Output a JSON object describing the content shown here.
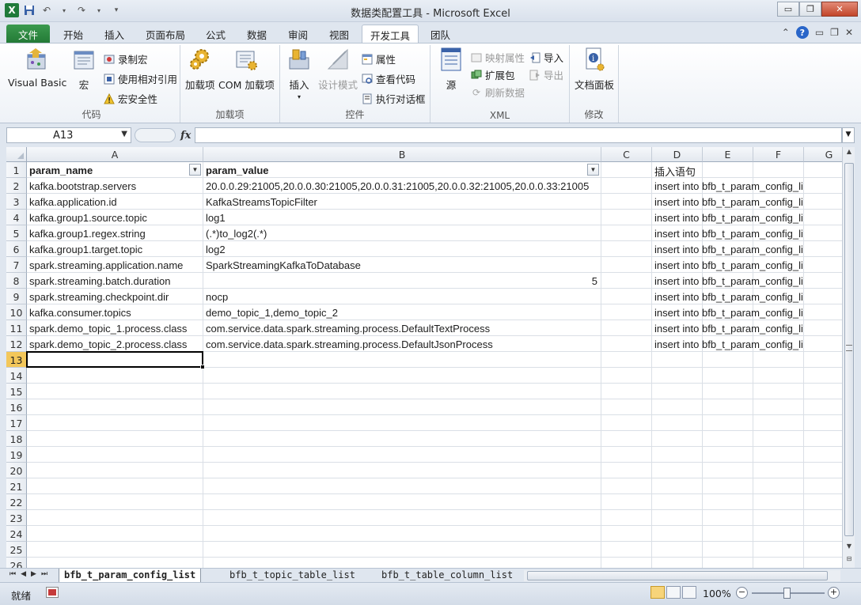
{
  "window": {
    "title": "数据类配置工具  -  Microsoft Excel",
    "minimize_glyph": "▭",
    "restore_glyph": "❐",
    "close_glyph": "✕",
    "logo": "X"
  },
  "ribbon_tabs": {
    "file": "文件",
    "start": "开始",
    "insert": "插入",
    "page_layout": "页面布局",
    "formulas": "公式",
    "data": "数据",
    "review": "审阅",
    "view": "视图",
    "developer": "开发工具",
    "team": "团队"
  },
  "ribbon": {
    "code": {
      "label": "代码",
      "visual_basic": "Visual Basic",
      "macros": "宏",
      "record_macro": "录制宏",
      "use_relative": "使用相对引用",
      "macro_security": "宏安全性"
    },
    "addins": {
      "label": "加载项",
      "addins": "加载项",
      "com_addins": "COM 加载项"
    },
    "controls": {
      "label": "控件",
      "insert": "插入",
      "design_mode": "设计模式",
      "properties": "属性",
      "view_code": "查看代码",
      "run_dialog": "执行对话框"
    },
    "xml": {
      "label": "XML",
      "source": "源",
      "map_properties": "映射属性",
      "expansion_packs": "扩展包",
      "refresh_data": "刷新数据",
      "import": "导入",
      "export": "导出"
    },
    "modify": {
      "label": "修改",
      "document_panel": "文档面板"
    }
  },
  "formula_bar": {
    "name_box": "A13",
    "fx": "fx",
    "formula": ""
  },
  "grid": {
    "columns": [
      "A",
      "B",
      "C",
      "D",
      "E",
      "F",
      "G"
    ],
    "rows": [
      "1",
      "2",
      "3",
      "4",
      "5",
      "6",
      "7",
      "8",
      "9",
      "10",
      "11",
      "12",
      "13",
      "14",
      "15",
      "16",
      "17",
      "18",
      "19",
      "20",
      "21",
      "22",
      "23",
      "24",
      "25",
      "26"
    ],
    "header_row": {
      "a": "param_name",
      "b": "param_value",
      "d": "插入语句"
    },
    "data_rows": [
      {
        "a": "kafka.bootstrap.servers",
        "b": "20.0.0.29:21005,20.0.0.30:21005,20.0.0.31:21005,20.0.0.32:21005,20.0.0.33:21005",
        "d": "insert into bfb_t_param_config_list val"
      },
      {
        "a": "kafka.application.id",
        "b": "KafkaStreamsTopicFilter",
        "d": "insert into bfb_t_param_config_list val"
      },
      {
        "a": "kafka.group1.source.topic",
        "b": "log1",
        "d": "insert into bfb_t_param_config_list val"
      },
      {
        "a": "kafka.group1.regex.string",
        "b": "(.*)to_log2(.*)",
        "d": "insert into bfb_t_param_config_list val"
      },
      {
        "a": "kafka.group1.target.topic",
        "b": "log2",
        "d": "insert into bfb_t_param_config_list val"
      },
      {
        "a": "spark.streaming.application.name",
        "b": "SparkStreamingKafkaToDatabase",
        "d": "insert into bfb_t_param_config_list val"
      },
      {
        "a": "spark.streaming.batch.duration",
        "b": "5",
        "d": "insert into bfb_t_param_config_list val"
      },
      {
        "a": "spark.streaming.checkpoint.dir",
        "b": "nocp",
        "d": "insert into bfb_t_param_config_list val"
      },
      {
        "a": "kafka.consumer.topics",
        "b": "demo_topic_1,demo_topic_2",
        "d": "insert into bfb_t_param_config_list val"
      },
      {
        "a": "spark.demo_topic_1.process.class",
        "b": "com.service.data.spark.streaming.process.DefaultTextProcess",
        "d": "insert into bfb_t_param_config_list val"
      },
      {
        "a": "spark.demo_topic_2.process.class",
        "b": "com.service.data.spark.streaming.process.DefaultJsonProcess",
        "d": "insert into bfb_t_param_config_list val"
      }
    ],
    "selected_cell": "A13"
  },
  "sheets": {
    "tab1": "bfb_t_param_config_list",
    "tab2": "bfb_t_topic_table_list",
    "tab3": "bfb_t_table_column_list"
  },
  "status": {
    "ready": "就绪",
    "zoom": "100%"
  },
  "colors": {
    "file_tab": "#237a36",
    "selected_row_header": "#f3c75a",
    "grid_line": "#dadfe6"
  }
}
